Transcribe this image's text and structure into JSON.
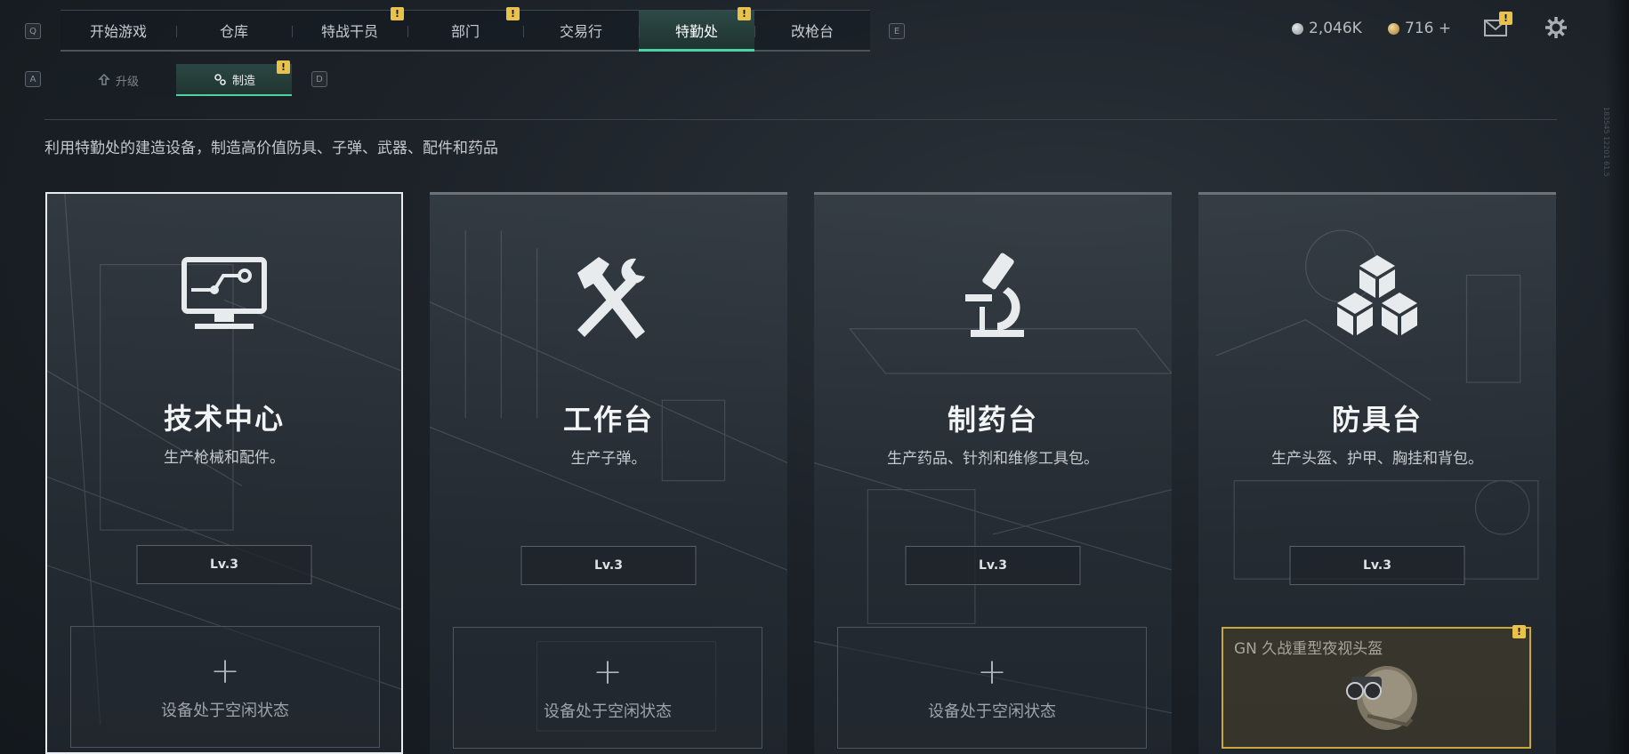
{
  "top_nav": {
    "left_key": "Q",
    "right_key": "E",
    "tabs": [
      {
        "label": "开始游戏",
        "badge": ""
      },
      {
        "label": "仓库",
        "badge": ""
      },
      {
        "label": "特战干员",
        "badge": "!"
      },
      {
        "label": "部门",
        "badge": "!"
      },
      {
        "label": "交易行",
        "badge": ""
      },
      {
        "label": "特勤处",
        "badge": "!"
      },
      {
        "label": "改枪台",
        "badge": ""
      }
    ],
    "active_index": 5
  },
  "currency": {
    "silver": "2,046K",
    "gold": "716 +"
  },
  "sub_nav": {
    "left_key": "A",
    "right_key": "D",
    "tabs": [
      {
        "label": "升级",
        "badge": ""
      },
      {
        "label": "制造",
        "badge": "!"
      }
    ],
    "active_index": 1
  },
  "description": "利用特勤处的建造设备，制造高价值防具、子弹、武器、配件和药品",
  "side_code": "183545 12201 61.5",
  "stations": [
    {
      "title": "技术中心",
      "subtitle": "生产枪械和配件。",
      "level": "Lv.3",
      "icon": "computer-icon",
      "slot_text": "设备处于空闲状态"
    },
    {
      "title": "工作台",
      "subtitle": "生产子弹。",
      "level": "Lv.3",
      "icon": "hammer-wrench-icon",
      "slot_text": "设备处于空闲状态"
    },
    {
      "title": "制药台",
      "subtitle": "生产药品、针剂和维修工具包。",
      "level": "Lv.3",
      "icon": "microscope-icon",
      "slot_text": "设备处于空闲状态"
    },
    {
      "title": "防具台",
      "subtitle": "生产头盔、护甲、胸挂和背包。",
      "level": "Lv.3",
      "icon": "cubes-icon",
      "slot_item": "GN 久战重型夜视头盔",
      "slot_badge": "!"
    }
  ],
  "colors": {
    "accent": "#4fd1a6",
    "alert": "#e8c24a",
    "busy_border": "#c9a83e"
  }
}
